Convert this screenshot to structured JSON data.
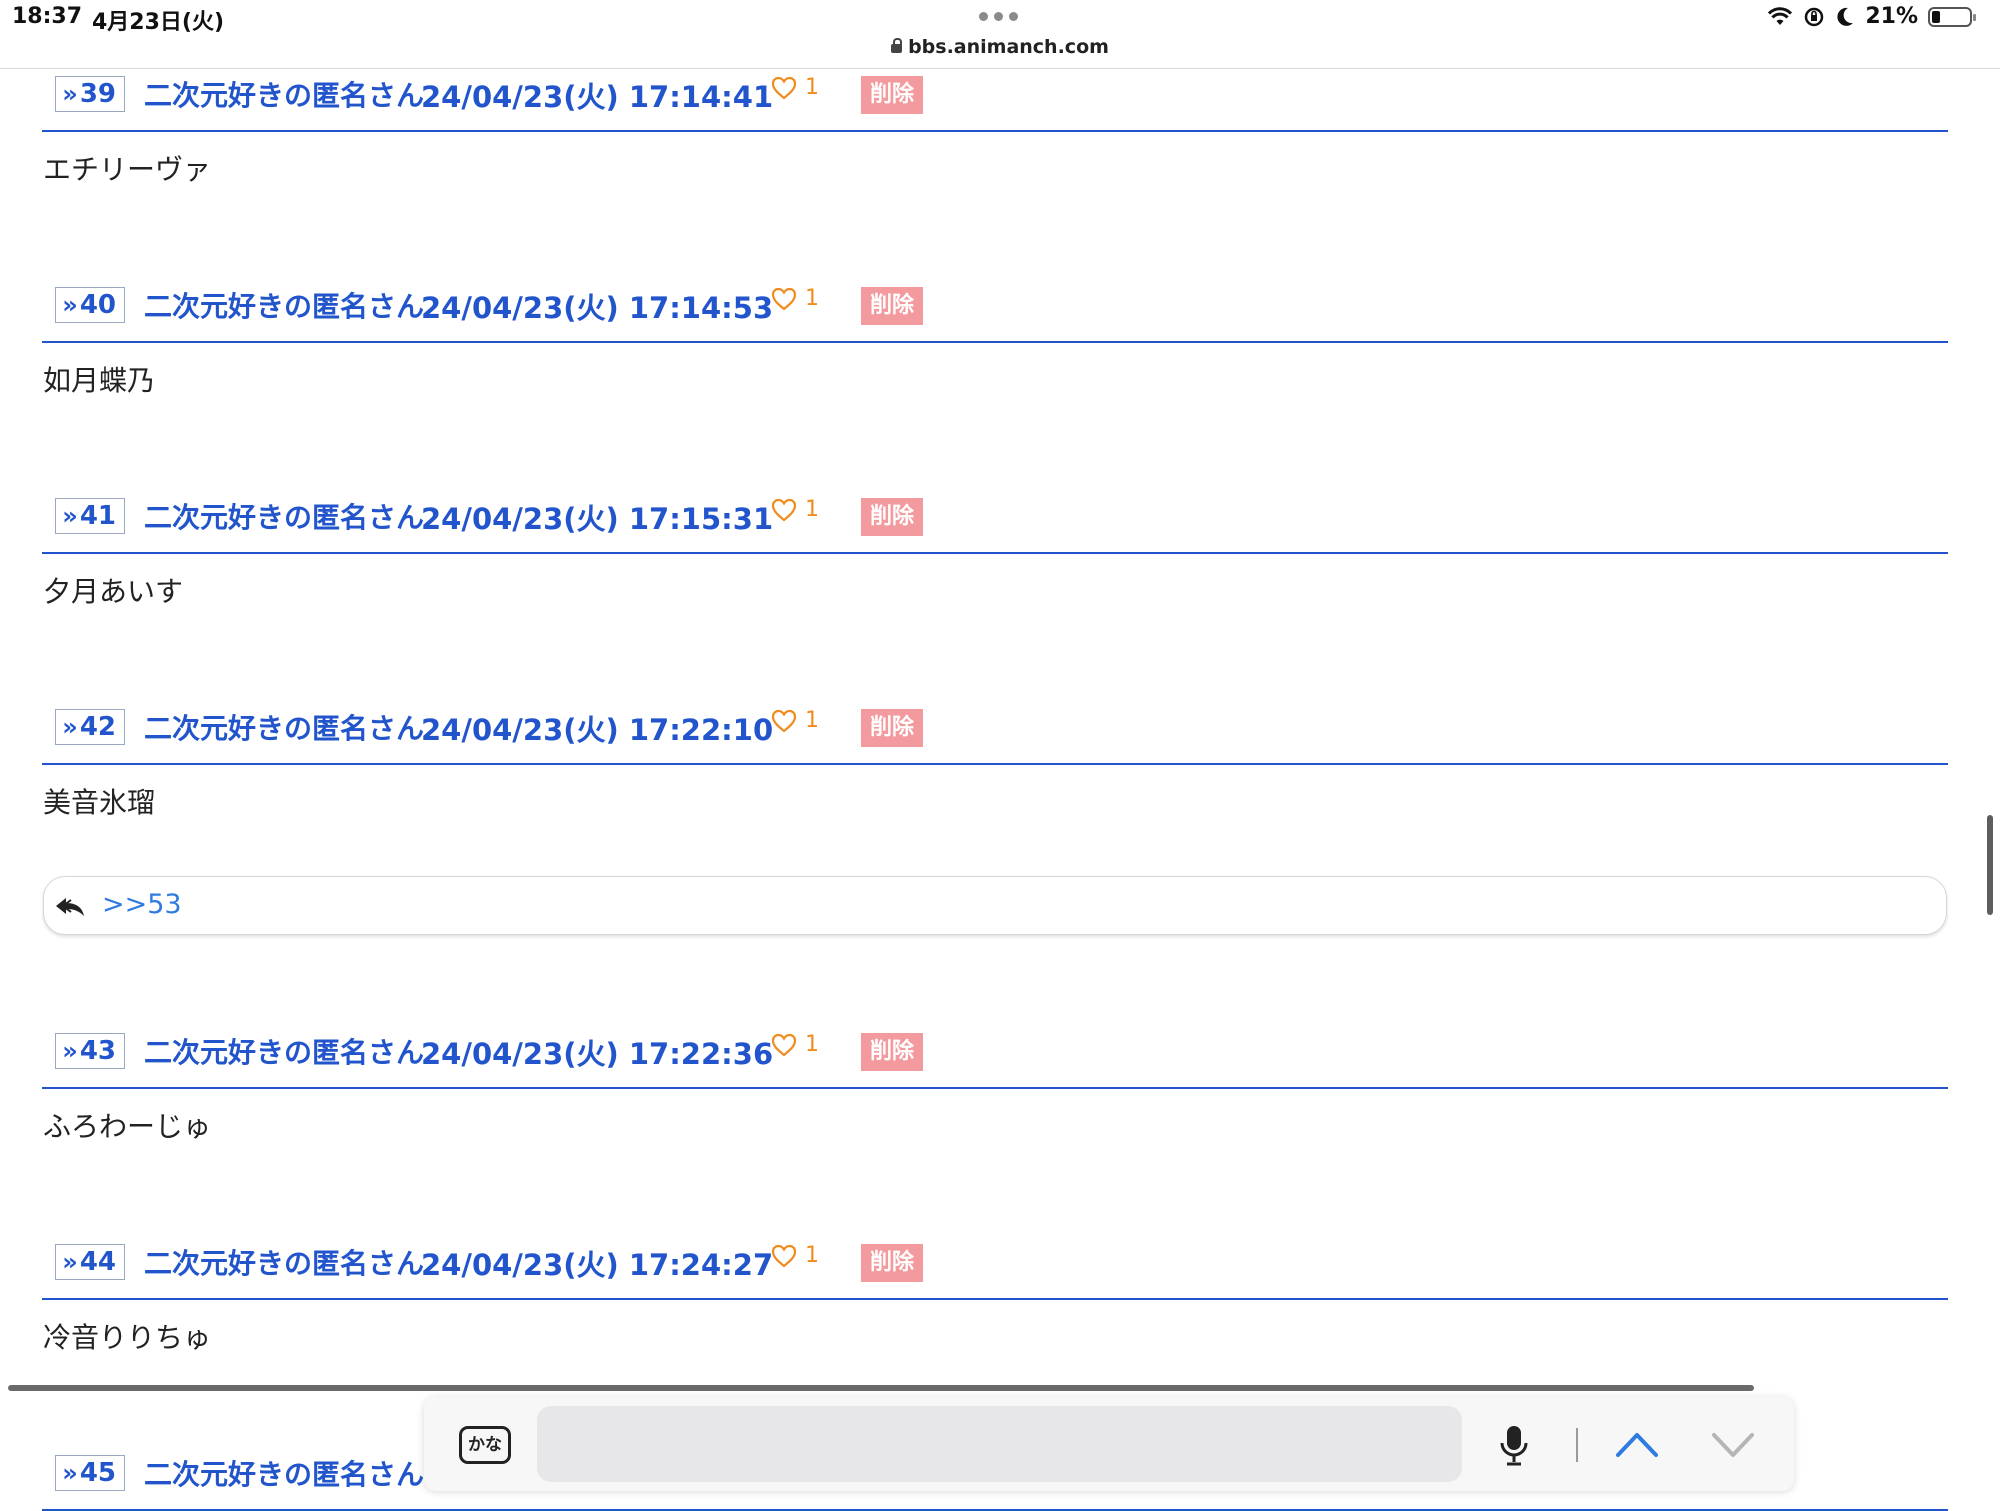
{
  "status_bar": {
    "time": "18:37",
    "date": "4月23日(火)",
    "url": "bbs.animanch.com",
    "battery": "21%",
    "battery_level": 0.21
  },
  "posts": [
    {
      "num": "39",
      "name": "二次元好きの匿名さん",
      "date": "24/04/23(火) 17:14:41",
      "likes": "1",
      "delete_label": "削除",
      "body": "エチリーヴァ"
    },
    {
      "num": "40",
      "name": "二次元好きの匿名さん",
      "date": "24/04/23(火) 17:14:53",
      "likes": "1",
      "delete_label": "削除",
      "body": "如月蝶乃"
    },
    {
      "num": "41",
      "name": "二次元好きの匿名さん",
      "date": "24/04/23(火) 17:15:31",
      "likes": "1",
      "delete_label": "削除",
      "body": "夕月あいす"
    },
    {
      "num": "42",
      "name": "二次元好きの匿名さん",
      "date": "24/04/23(火) 17:22:10",
      "likes": "1",
      "delete_label": "削除",
      "body": "美音氷瑠"
    },
    {
      "num": "43",
      "name": "二次元好きの匿名さん",
      "date": "24/04/23(火) 17:22:36",
      "likes": "1",
      "delete_label": "削除",
      "body": "ふろわーじゅ"
    },
    {
      "num": "44",
      "name": "二次元好きの匿名さん",
      "date": "24/04/23(火) 17:24:27",
      "likes": "1",
      "delete_label": "削除",
      "body": "冷音りりちゅ"
    },
    {
      "num": "45",
      "name": "二次元好きの匿名さん",
      "date": "",
      "likes": "",
      "delete_label": "",
      "body": ""
    }
  ],
  "reply": {
    "link": ">>53"
  },
  "find_bar": {
    "kana_label": "かな",
    "input_value": "",
    "input_placeholder": ""
  }
}
